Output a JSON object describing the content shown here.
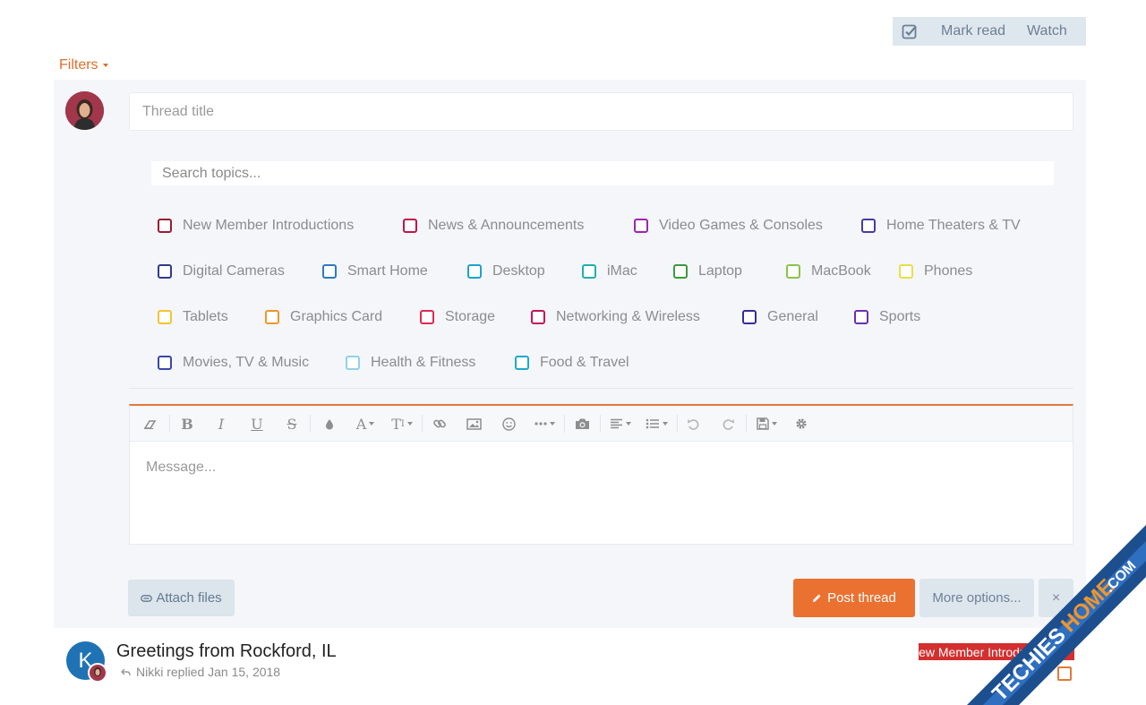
{
  "top_actions": {
    "mark_read": "Mark read",
    "watch": "Watch"
  },
  "filters": {
    "label": "Filters"
  },
  "new_thread": {
    "title_placeholder": "Thread title",
    "search_topics_placeholder": "Search topics...",
    "topics": [
      {
        "label": "New Member Introductions",
        "color": "#9b1b30"
      },
      {
        "label": "News & Announcements",
        "color": "#c0154a"
      },
      {
        "label": "Video Games & Consoles",
        "color": "#9c27b0"
      },
      {
        "label": "Home Theaters & TV",
        "color": "#4a3aa6"
      },
      {
        "label": "Digital Cameras",
        "color": "#2f3b8f"
      },
      {
        "label": "Smart Home",
        "color": "#2b7bc1"
      },
      {
        "label": "Desktop",
        "color": "#1fa3c9"
      },
      {
        "label": "iMac",
        "color": "#1fb0b0"
      },
      {
        "label": "Laptop",
        "color": "#3c9a3c"
      },
      {
        "label": "MacBook",
        "color": "#8bc34a"
      },
      {
        "label": "Phones",
        "color": "#e6e04a"
      },
      {
        "label": "Tablets",
        "color": "#f4c430"
      },
      {
        "label": "Graphics Card",
        "color": "#f0952a"
      },
      {
        "label": "Storage",
        "color": "#e0294e"
      },
      {
        "label": "Networking & Wireless",
        "color": "#c2185b"
      },
      {
        "label": "General",
        "color": "#3b2a9c"
      },
      {
        "label": "Sports",
        "color": "#6a2fb5"
      },
      {
        "label": "Movies, TV & Music",
        "color": "#3a47a8"
      },
      {
        "label": "Health & Fitness",
        "color": "#8fd2e8"
      },
      {
        "label": "Food & Travel",
        "color": "#1ea9c9"
      }
    ],
    "message_placeholder": "Message...",
    "attach_files": "Attach files",
    "post_thread": "Post thread",
    "more_options": "More options...",
    "close": "×"
  },
  "thread": {
    "avatar_letter": "K",
    "title": "Greetings from Rockford, IL",
    "meta": "Nikki replied Jan 15, 2018",
    "prefix": "New Member Introductions",
    "prefix_color": "#d32f2f"
  },
  "watermark": {
    "text": "TECHIESHOME.COM"
  }
}
